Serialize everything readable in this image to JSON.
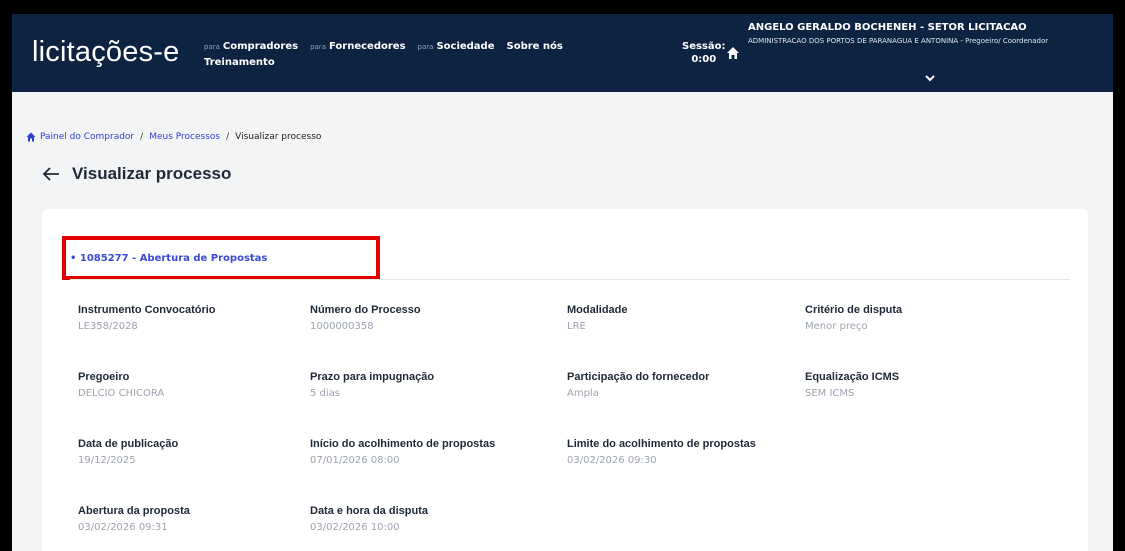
{
  "header": {
    "logo": "licitações-e",
    "nav": [
      {
        "prefix": "para",
        "label": "Compradores"
      },
      {
        "prefix": "para",
        "label": "Fornecedores"
      },
      {
        "prefix": "para",
        "label": "Sociedade"
      },
      {
        "prefix": "",
        "label": "Sobre nós"
      }
    ],
    "nav_row2": "Treinamento",
    "session_label": "Sessão:",
    "session_time": "0:00",
    "user_name": "ANGELO GERALDO BOCHENEH - SETOR LICITACAO",
    "user_org": "ADMINISTRACAO DOS PORTOS DE PARANAGUA E ANTONINA - Pregoeiro/ Coordenador",
    "icons": {
      "home": "home-icon",
      "caret": "chevron-down-icon"
    }
  },
  "breadcrumb": {
    "items": [
      "Painel do Comprador",
      "Meus Processos",
      "Visualizar processo"
    ],
    "separator": "/"
  },
  "page": {
    "title": "Visualizar processo"
  },
  "process": {
    "header": "• 1085277 - Abertura de Propostas",
    "fields": [
      {
        "label": "Instrumento Convocatório",
        "value": "LE358/2028"
      },
      {
        "label": "Número do Processo",
        "value": "1000000358"
      },
      {
        "label": "Modalidade",
        "value": "LRE"
      },
      {
        "label": "Critério de disputa",
        "value": "Menor preço"
      },
      {
        "label": "Pregoeiro",
        "value": "DELCIO CHICORA"
      },
      {
        "label": "Prazo para impugnação",
        "value": "5 dias"
      },
      {
        "label": "Participação do fornecedor",
        "value": "Ampla"
      },
      {
        "label": "Equalização ICMS",
        "value": "SEM ICMS"
      },
      {
        "label": "Data de publicação",
        "value": "19/12/2025"
      },
      {
        "label": "Início do acolhimento de propostas",
        "value": "07/01/2026 08:00"
      },
      {
        "label": "Limite do acolhimento de propostas",
        "value": "03/02/2026 09:30"
      },
      {
        "label": "Abertura da proposta",
        "value": "03/02/2026 09:31"
      },
      {
        "label": "Data e hora da disputa",
        "value": "03/02/2026 10:00"
      }
    ]
  },
  "colors": {
    "header_bg": "#0d2341",
    "link": "#3b49d6",
    "highlight": "#e00000"
  }
}
